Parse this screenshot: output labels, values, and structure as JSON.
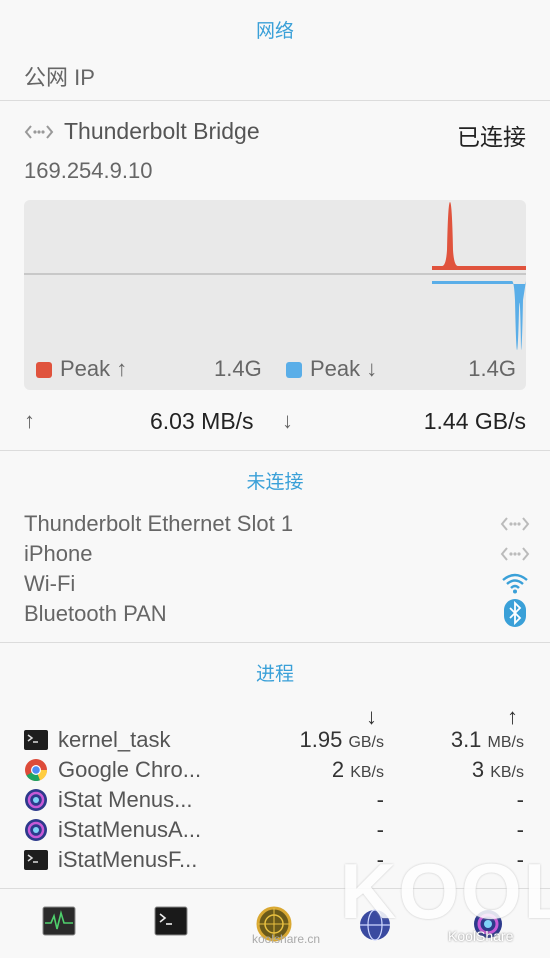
{
  "network": {
    "title": "网络",
    "public_ip_label": "公网 IP",
    "interface": {
      "name": "Thunderbolt Bridge",
      "status": "已连接",
      "ip": "169.254.9.10",
      "legend": {
        "up_label": "Peak ↑",
        "up_value": "1.4G",
        "down_label": "Peak ↓",
        "down_value": "1.4G",
        "up_color": "#e0533d",
        "down_color": "#5aaee8"
      },
      "upload_arrow": "↑",
      "upload_rate": "6.03 MB/s",
      "download_arrow": "↓",
      "download_rate": "1.44 GB/s"
    }
  },
  "disconnected": {
    "title": "未连接",
    "items": [
      {
        "name": "Thunderbolt Ethernet Slot 1",
        "icon": "ethernet-icon"
      },
      {
        "name": "iPhone",
        "icon": "ethernet-icon"
      },
      {
        "name": "Wi-Fi",
        "icon": "wifi-icon"
      },
      {
        "name": "Bluetooth PAN",
        "icon": "bluetooth-icon"
      }
    ]
  },
  "processes": {
    "title": "进程",
    "down_arrow": "↓",
    "up_arrow": "↑",
    "rows": [
      {
        "name": "kernel_task",
        "down_num": "1.95",
        "down_unit": "GB/s",
        "up_num": "3.1",
        "up_unit": "MB/s",
        "icon": "terminal-icon"
      },
      {
        "name": "Google Chro...",
        "down_num": "2",
        "down_unit": "KB/s",
        "up_num": "3",
        "up_unit": "KB/s",
        "icon": "chrome-icon"
      },
      {
        "name": "iStat Menus...",
        "down_num": "-",
        "down_unit": "",
        "up_num": "-",
        "up_unit": "",
        "icon": "istat-icon"
      },
      {
        "name": "iStatMenusA...",
        "down_num": "-",
        "down_unit": "",
        "up_num": "-",
        "up_unit": "",
        "icon": "istat-icon"
      },
      {
        "name": "iStatMenusF...",
        "down_num": "-",
        "down_unit": "",
        "up_num": "-",
        "up_unit": "",
        "icon": "terminal-icon"
      }
    ]
  },
  "dock": {
    "watermark_big": "KOOL",
    "watermark_small": "KoolShare",
    "watermark_url": "koolshare.cn"
  }
}
